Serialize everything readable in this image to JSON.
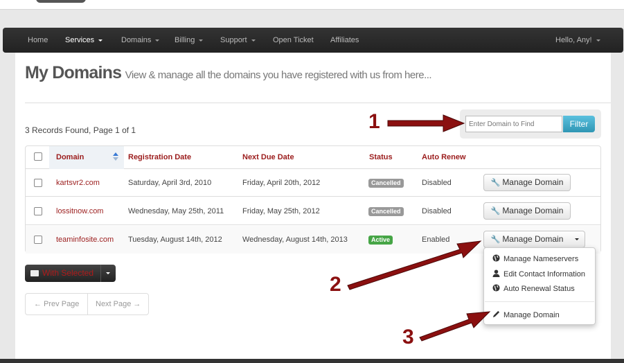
{
  "nav": {
    "items": [
      {
        "label": "Home"
      },
      {
        "label": "Services"
      },
      {
        "label": "Domains"
      },
      {
        "label": "Billing"
      },
      {
        "label": "Support"
      },
      {
        "label": "Open Ticket"
      },
      {
        "label": "Affiliates"
      }
    ],
    "user_label": "Hello, Any!"
  },
  "page": {
    "title": "My Domains",
    "subtitle": "View & manage all the domains you have registered with us from here...",
    "records_text": "3 Records Found, Page 1 of 1"
  },
  "filter": {
    "placeholder": "Enter Domain to Find",
    "button_label": "Filter"
  },
  "table": {
    "headers": {
      "domain": "Domain",
      "registration_date": "Registration Date",
      "next_due_date": "Next Due Date",
      "status": "Status",
      "auto_renew": "Auto Renew"
    },
    "rows": [
      {
        "domain": "kartsvr2.com",
        "registration_date": "Saturday, April 3rd, 2010",
        "next_due_date": "Friday, April 20th, 2012",
        "status": "Cancelled",
        "auto_renew": "Disabled",
        "action": "Manage Domain"
      },
      {
        "domain": "lossitnow.com",
        "registration_date": "Wednesday, May 25th, 2011",
        "next_due_date": "Friday, May 25th, 2012",
        "status": "Cancelled",
        "auto_renew": "Disabled",
        "action": "Manage Domain"
      },
      {
        "domain": "teaminfosite.com",
        "registration_date": "Tuesday, August 14th, 2012",
        "next_due_date": "Wednesday, August 14th, 2013",
        "status": "Active",
        "auto_renew": "Enabled",
        "action": "Manage Domain"
      }
    ]
  },
  "dropdown": {
    "items": [
      {
        "label": "Manage Nameservers",
        "icon": "globe-icon"
      },
      {
        "label": "Edit Contact Information",
        "icon": "user-icon"
      },
      {
        "label": "Auto Renewal Status",
        "icon": "globe-icon"
      },
      {
        "label": "Manage Domain",
        "icon": "pencil-icon"
      }
    ]
  },
  "bulk": {
    "label": "With Selected"
  },
  "pager": {
    "prev": "← Prev Page",
    "next": "Next Page →"
  },
  "annotations": [
    "1",
    "2",
    "3"
  ],
  "colors": {
    "accent_red": "#9b1c1c",
    "filter_blue": "#2f96b4",
    "status_active": "#46a546",
    "status_cancelled": "#999999",
    "arrow_red": "#8b1010"
  }
}
